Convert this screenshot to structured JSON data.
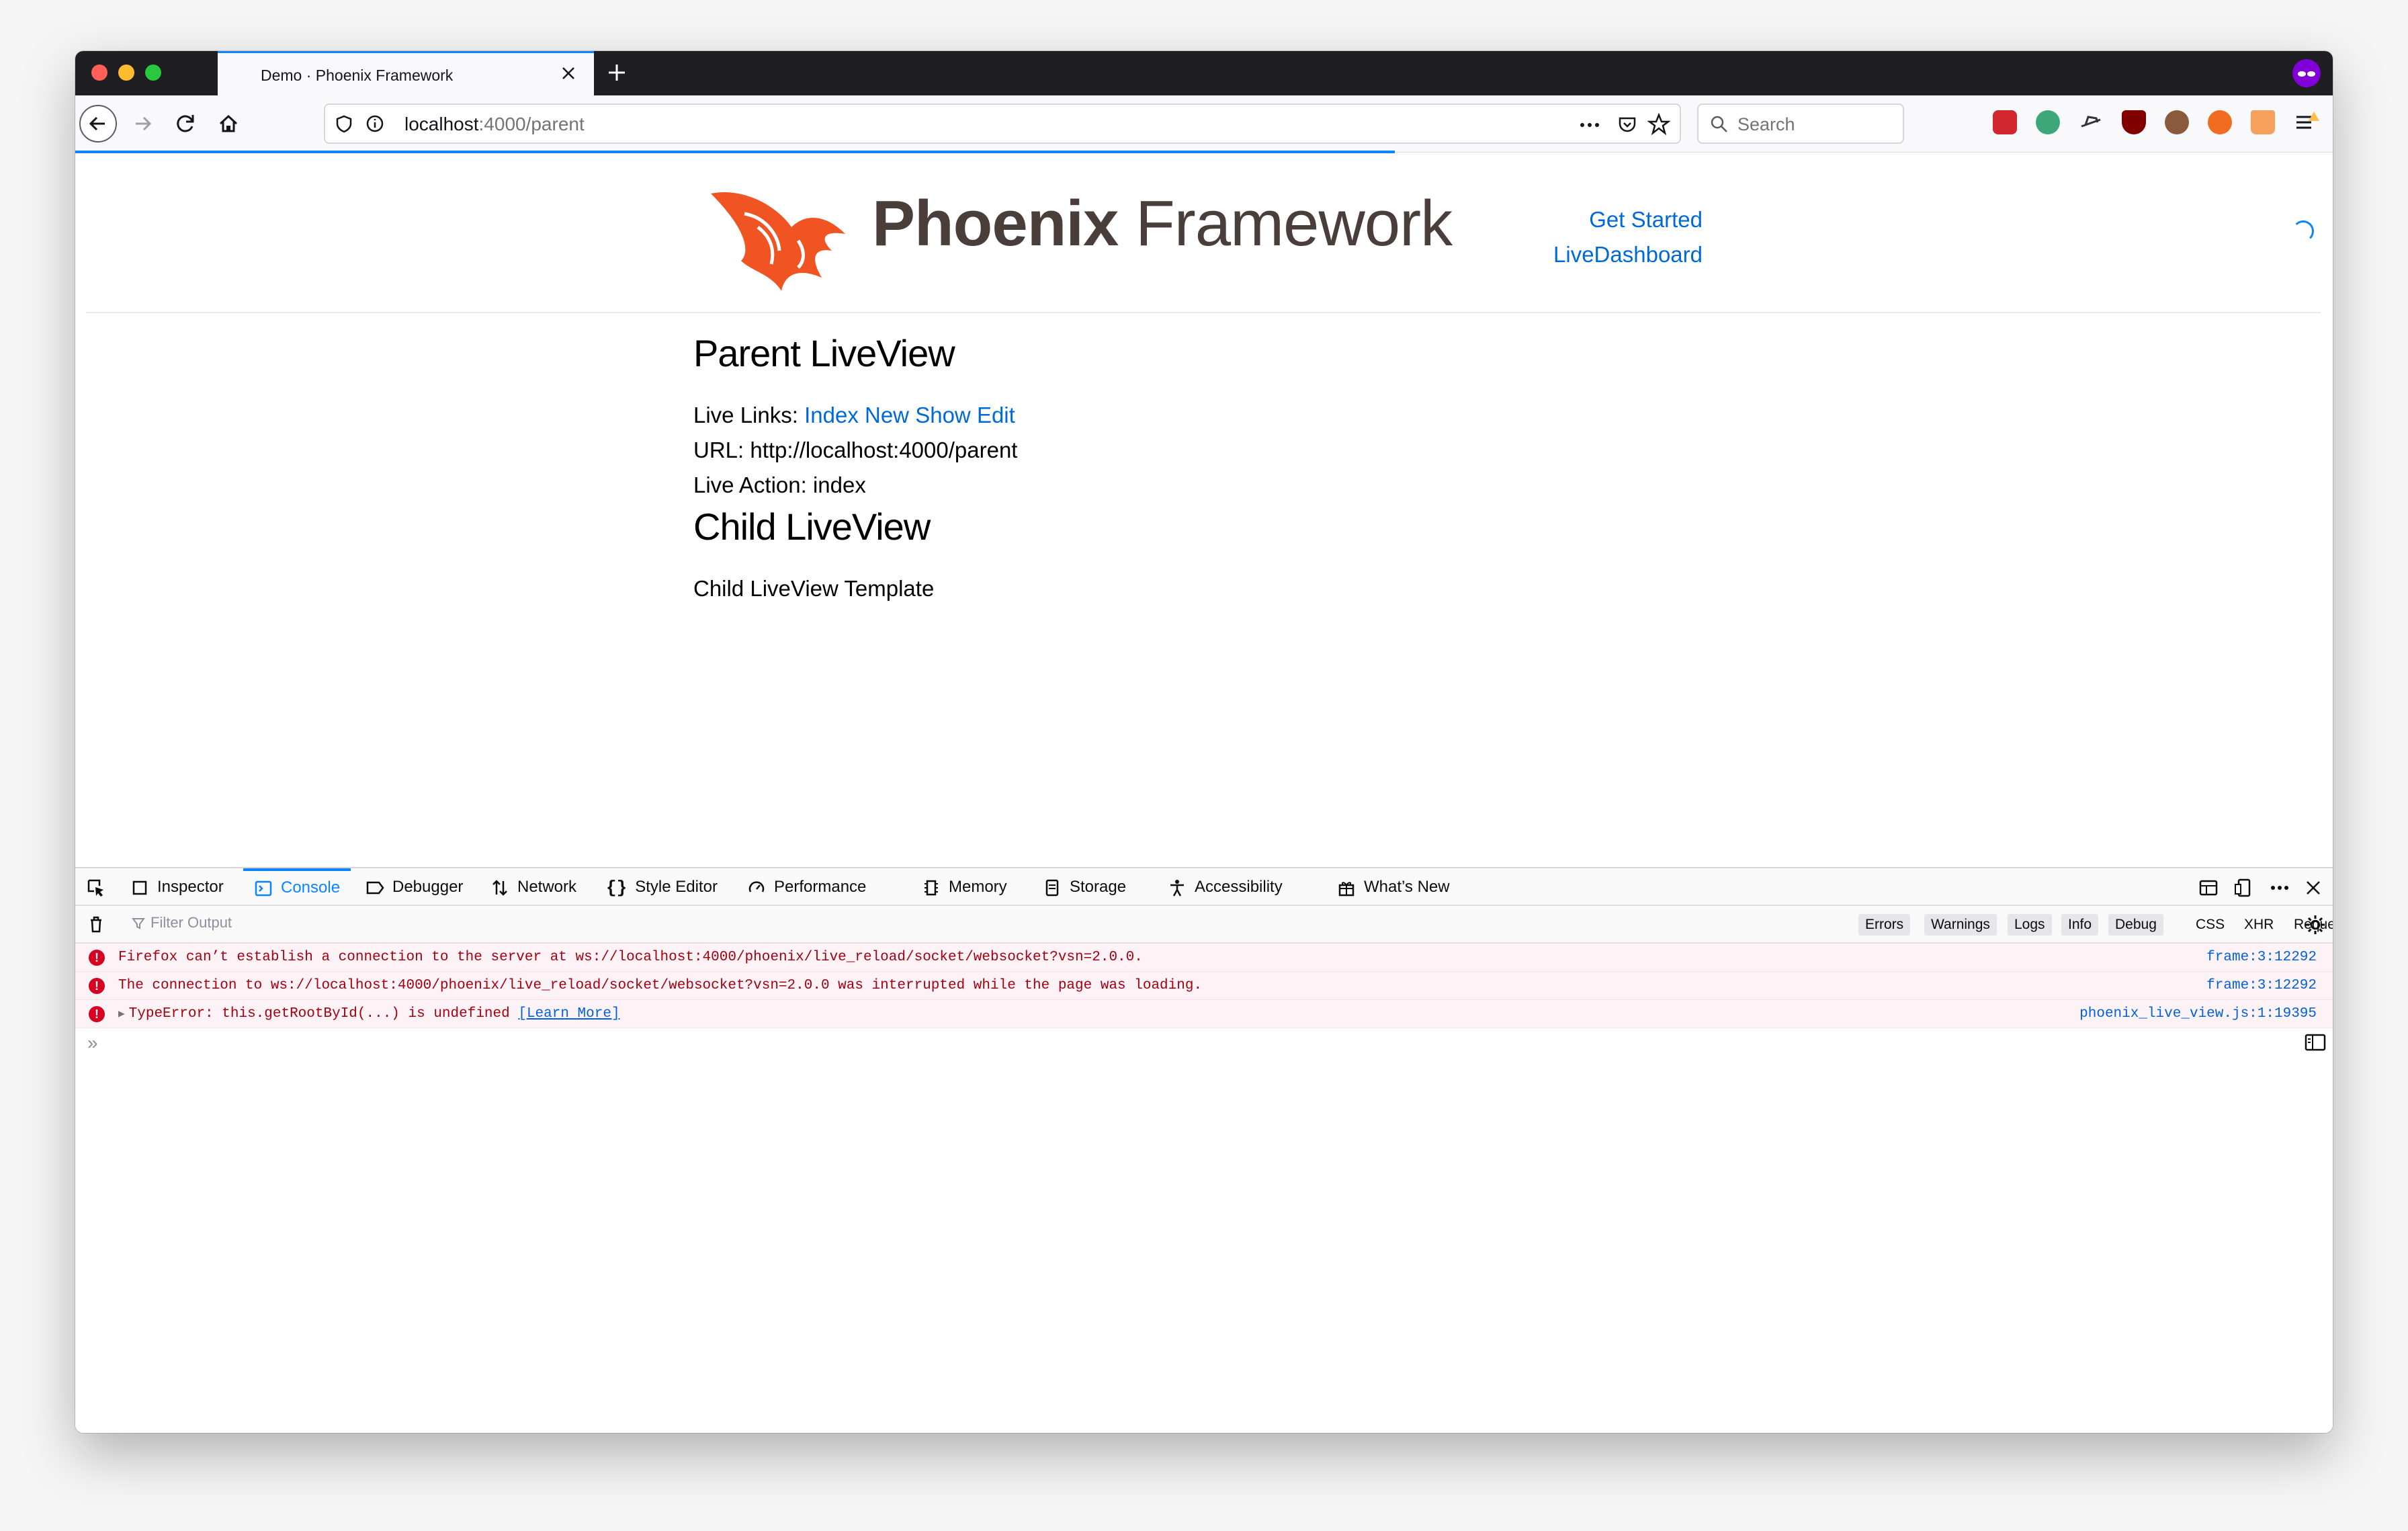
{
  "browser": {
    "tab_title": "Demo · Phoenix Framework",
    "url_host": "localhost",
    "url_rest": ":4000/parent",
    "search_placeholder": "Search"
  },
  "site": {
    "logo_bold": "Phoenix",
    "logo_light": "Framework",
    "nav": [
      "Get Started",
      "LiveDashboard"
    ]
  },
  "content": {
    "heading1": "Parent LiveView",
    "live_links_label": "Live Links:",
    "live_links": [
      "Index",
      "New",
      "Show",
      "Edit"
    ],
    "url_line": "URL: http://localhost:4000/parent",
    "live_action_line": "Live Action: index",
    "heading2": "Child LiveView",
    "child_template": "Child LiveView Template"
  },
  "devtools": {
    "tabs": [
      "Inspector",
      "Console",
      "Debugger",
      "Network",
      "Style Editor",
      "Performance",
      "Memory",
      "Storage",
      "Accessibility",
      "What’s New"
    ],
    "active_tab": "Console",
    "filter_placeholder": "Filter Output",
    "level_filters": [
      "Errors",
      "Warnings",
      "Logs",
      "Info",
      "Debug"
    ],
    "type_filters": [
      "CSS",
      "XHR",
      "Requests"
    ],
    "messages": [
      {
        "text": "Firefox can’t establish a connection to the server at ws://localhost:4000/phoenix/live_reload/socket/websocket?vsn=2.0.0.",
        "source": "frame:3:12292"
      },
      {
        "text": "The connection to ws://localhost:4000/phoenix/live_reload/socket/websocket?vsn=2.0.0 was interrupted while the page was loading.",
        "source": "frame:3:12292"
      },
      {
        "text": "TypeError: this.getRootById(...) is undefined",
        "learn_more": "[Learn More]",
        "source": "phoenix_live_view.js:1:19395"
      }
    ],
    "prompt": "»"
  },
  "colors": {
    "accent": "#0a84ff",
    "link": "#0069d9",
    "error": "#a4000f",
    "phoenix_orange": "#f05423"
  }
}
